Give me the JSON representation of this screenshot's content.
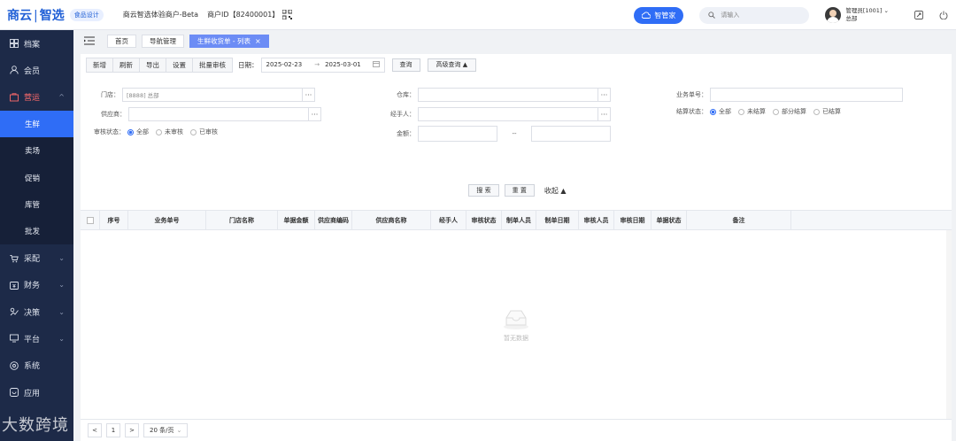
{
  "header": {
    "logo": "商云",
    "logo_sub": "智选",
    "badge": "食品设计",
    "merchant": "商云智选体验商户-Beta",
    "merchant_id": "商户ID【82400001】",
    "cloud_btn": "智管家",
    "search_placeholder": "请输入",
    "user_name": "管理员[1001]",
    "user_store": "总部"
  },
  "sidebar": {
    "items": [
      {
        "label": "档案",
        "icon": "archive-icon"
      },
      {
        "label": "会员",
        "icon": "member-icon"
      },
      {
        "label": "营运",
        "icon": "operation-icon"
      },
      {
        "label": "采配",
        "icon": "purchase-icon"
      },
      {
        "label": "财务",
        "icon": "finance-icon"
      },
      {
        "label": "决策",
        "icon": "decision-icon"
      },
      {
        "label": "平台",
        "icon": "platform-icon"
      },
      {
        "label": "系统",
        "icon": "system-icon"
      },
      {
        "label": "应用",
        "icon": "app-icon"
      }
    ],
    "subitems": [
      "生鲜",
      "卖场",
      "促销",
      "库管",
      "批发"
    ],
    "accent": "#2f6df6"
  },
  "tabs": {
    "home": "首页",
    "nav": "导航管理",
    "active": "生鲜收货单 - 列表"
  },
  "toolbar": {
    "add": "新增",
    "refresh": "刷新",
    "export": "导出",
    "settings": "设置",
    "batch_review": "批量审核",
    "date_label": "日期：",
    "date_start": "2025-02-23",
    "date_end": "2025-03-01",
    "date_arrow": "→",
    "query": "查询",
    "advanced": "高级查询 ▲"
  },
  "filters": {
    "store_label": "门店：",
    "store_value": "[8888] 总部",
    "warehouse_label": "仓库：",
    "biz_no_label": "业务单号：",
    "supplier_label": "供应商：",
    "handler_label": "经手人：",
    "settle_label": "结算状态：",
    "settle_options": [
      "全部",
      "未结算",
      "部分结算",
      "已结算"
    ],
    "review_label": "审核状态：",
    "review_options": [
      "全部",
      "未审核",
      "已审核"
    ],
    "amount_label": "金额：",
    "amount_sep": "--"
  },
  "actions": {
    "search": "搜 索",
    "reset": "重 置",
    "collapse": "收起 ▲"
  },
  "table": {
    "columns": [
      "序号",
      "业务单号",
      "门店名称",
      "单据金额",
      "供应商编码",
      "供应商名称",
      "经手人",
      "审核状态",
      "制单人员",
      "制单日期",
      "审核人员",
      "审核日期",
      "单据状态",
      "备注"
    ],
    "empty": "暂无数据"
  },
  "pager": {
    "page": "1",
    "page_size": "20 条/页",
    "prev": "<",
    "next": ">"
  },
  "watermark": "大数跨境"
}
